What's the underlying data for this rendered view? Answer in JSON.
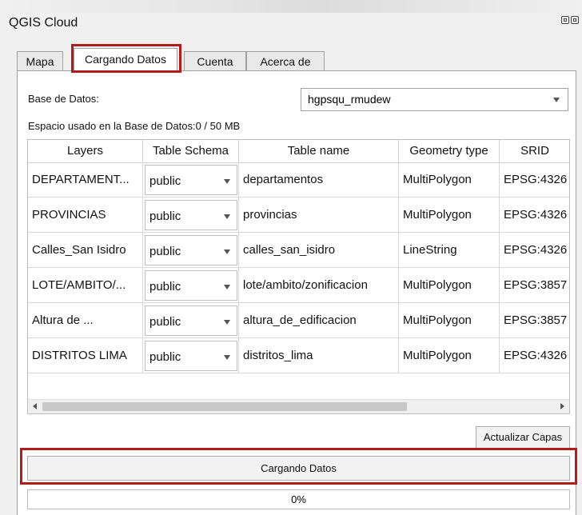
{
  "window": {
    "title": "QGIS Cloud"
  },
  "tabs": [
    {
      "label": "Mapa",
      "active": false
    },
    {
      "label": "Cargando Datos",
      "active": true
    },
    {
      "label": "Cuenta",
      "active": false
    },
    {
      "label": "Acerca de",
      "active": false
    }
  ],
  "database": {
    "label": "Base de Datos:",
    "selected": "hgpsqu_rmudew",
    "space_used": "Espacio usado en la Base de Datos:0 / 50 MB"
  },
  "table": {
    "headers": [
      "Layers",
      "Table Schema",
      "Table name",
      "Geometry type",
      "SRID"
    ],
    "rows": [
      {
        "layer": "DEPARTAMENT...",
        "schema": "public",
        "table": "departamentos",
        "geom": "MultiPolygon",
        "srid": "EPSG:4326"
      },
      {
        "layer": "PROVINCIAS",
        "schema": "public",
        "table": "provincias",
        "geom": "MultiPolygon",
        "srid": "EPSG:4326"
      },
      {
        "layer": "Calles_San Isidro",
        "schema": "public",
        "table": "calles_san_isidro",
        "geom": "LineString",
        "srid": "EPSG:4326"
      },
      {
        "layer": "LOTE/AMBITO/...",
        "schema": "public",
        "table": "lote/ambito/zonificacion",
        "geom": "MultiPolygon",
        "srid": "EPSG:3857"
      },
      {
        "layer": "Altura de ...",
        "schema": "public",
        "table": "altura_de_edificacion",
        "geom": "MultiPolygon",
        "srid": "EPSG:3857"
      },
      {
        "layer": "DISTRITOS LIMA",
        "schema": "public",
        "table": "distritos_lima",
        "geom": "MultiPolygon",
        "srid": "EPSG:4326"
      }
    ]
  },
  "buttons": {
    "refresh": "Actualizar Capas",
    "upload": "Cargando Datos"
  },
  "progress": {
    "value": 0,
    "text": "0%"
  },
  "colors": {
    "highlight": "#b21c1c"
  }
}
